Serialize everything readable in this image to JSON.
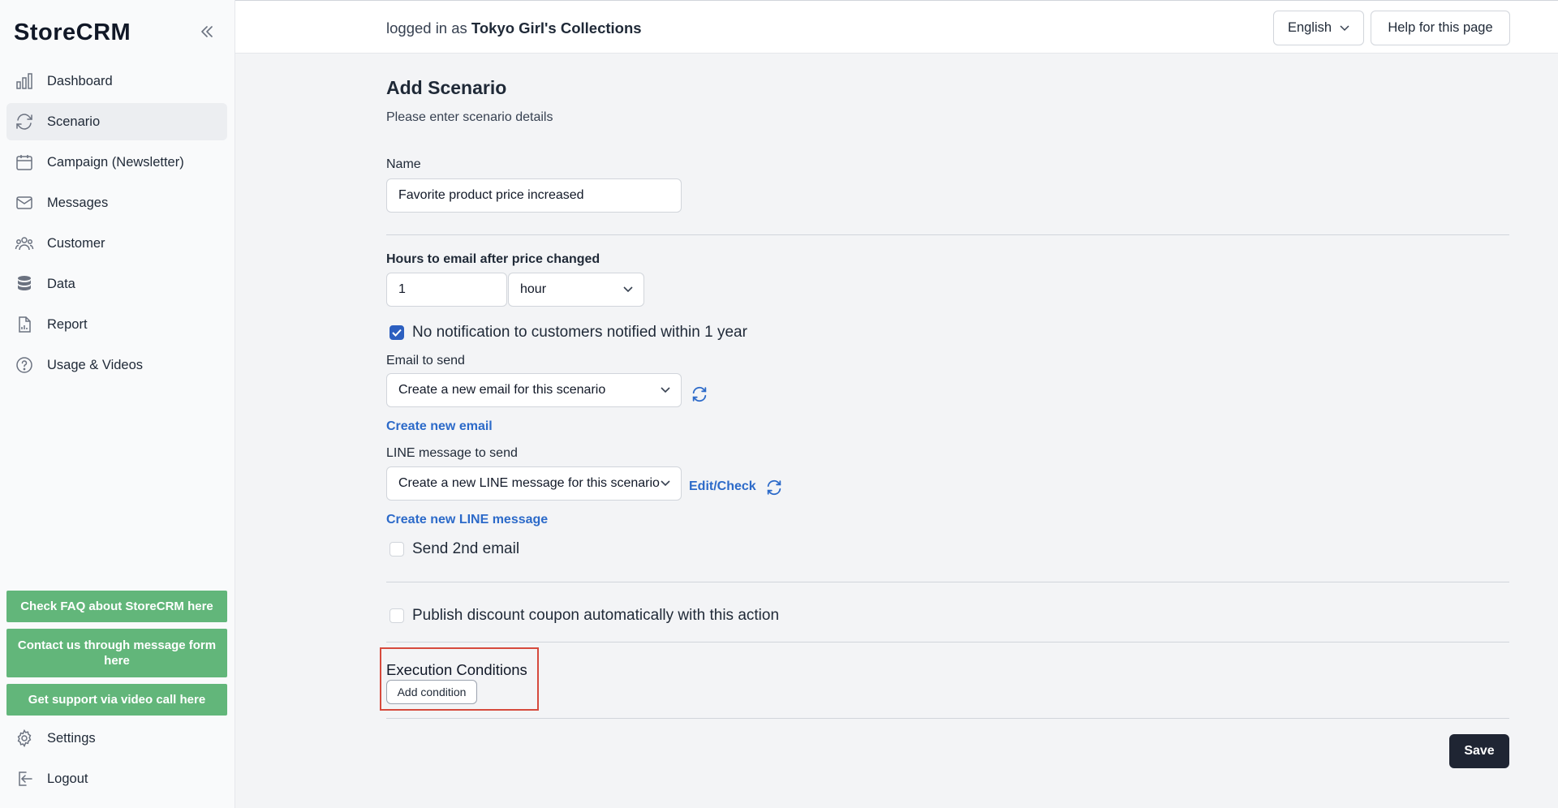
{
  "app": {
    "logo": "StoreCRM"
  },
  "sidebar": {
    "items": [
      {
        "label": "Dashboard",
        "icon": "bar-chart-icon"
      },
      {
        "label": "Scenario",
        "icon": "refresh-icon",
        "active": true
      },
      {
        "label": "Campaign (Newsletter)",
        "icon": "calendar-icon"
      },
      {
        "label": "Messages",
        "icon": "envelope-icon"
      },
      {
        "label": "Customer",
        "icon": "users-icon"
      },
      {
        "label": "Data",
        "icon": "database-icon"
      },
      {
        "label": "Report",
        "icon": "document-chart-icon"
      },
      {
        "label": "Usage & Videos",
        "icon": "question-circle-icon"
      }
    ],
    "help_buttons": [
      "Check FAQ about StoreCRM here",
      "Contact us through message form here",
      "Get support via video call here"
    ],
    "bottom_items": [
      {
        "label": "Settings",
        "icon": "gear-icon"
      },
      {
        "label": "Logout",
        "icon": "logout-icon"
      }
    ]
  },
  "header": {
    "logged_prefix": "logged in as",
    "store_name": "Tokyo Girl's Collections",
    "language": "English",
    "help_button": "Help for this page"
  },
  "form": {
    "title": "Add Scenario",
    "subtitle": "Please enter scenario details",
    "name_label": "Name",
    "name_value": "Favorite product price increased",
    "hours_label": "Hours to email after price changed",
    "hours_value": "1",
    "hours_unit": "hour",
    "no_notify_label": "No notification to customers notified within 1 year",
    "no_notify_checked": true,
    "email_label": "Email to send",
    "email_selected": "Create a new email for this scenario",
    "create_email_link": "Create new email",
    "line_label": "LINE message to send",
    "line_selected": "Create a new LINE message for this scenario",
    "edit_check_link": "Edit/Check",
    "create_line_link": "Create new LINE message",
    "second_email_label": "Send 2nd email",
    "second_email_checked": false,
    "coupon_label": "Publish discount coupon automatically with this action",
    "coupon_checked": false,
    "exec_title": "Execution Conditions",
    "add_condition": "Add condition",
    "save": "Save"
  },
  "colors": {
    "accent_blue": "#2c6ac9",
    "help_green": "#62b67a",
    "save_dark": "#1f2533",
    "highlight_red": "#d64a3d"
  }
}
